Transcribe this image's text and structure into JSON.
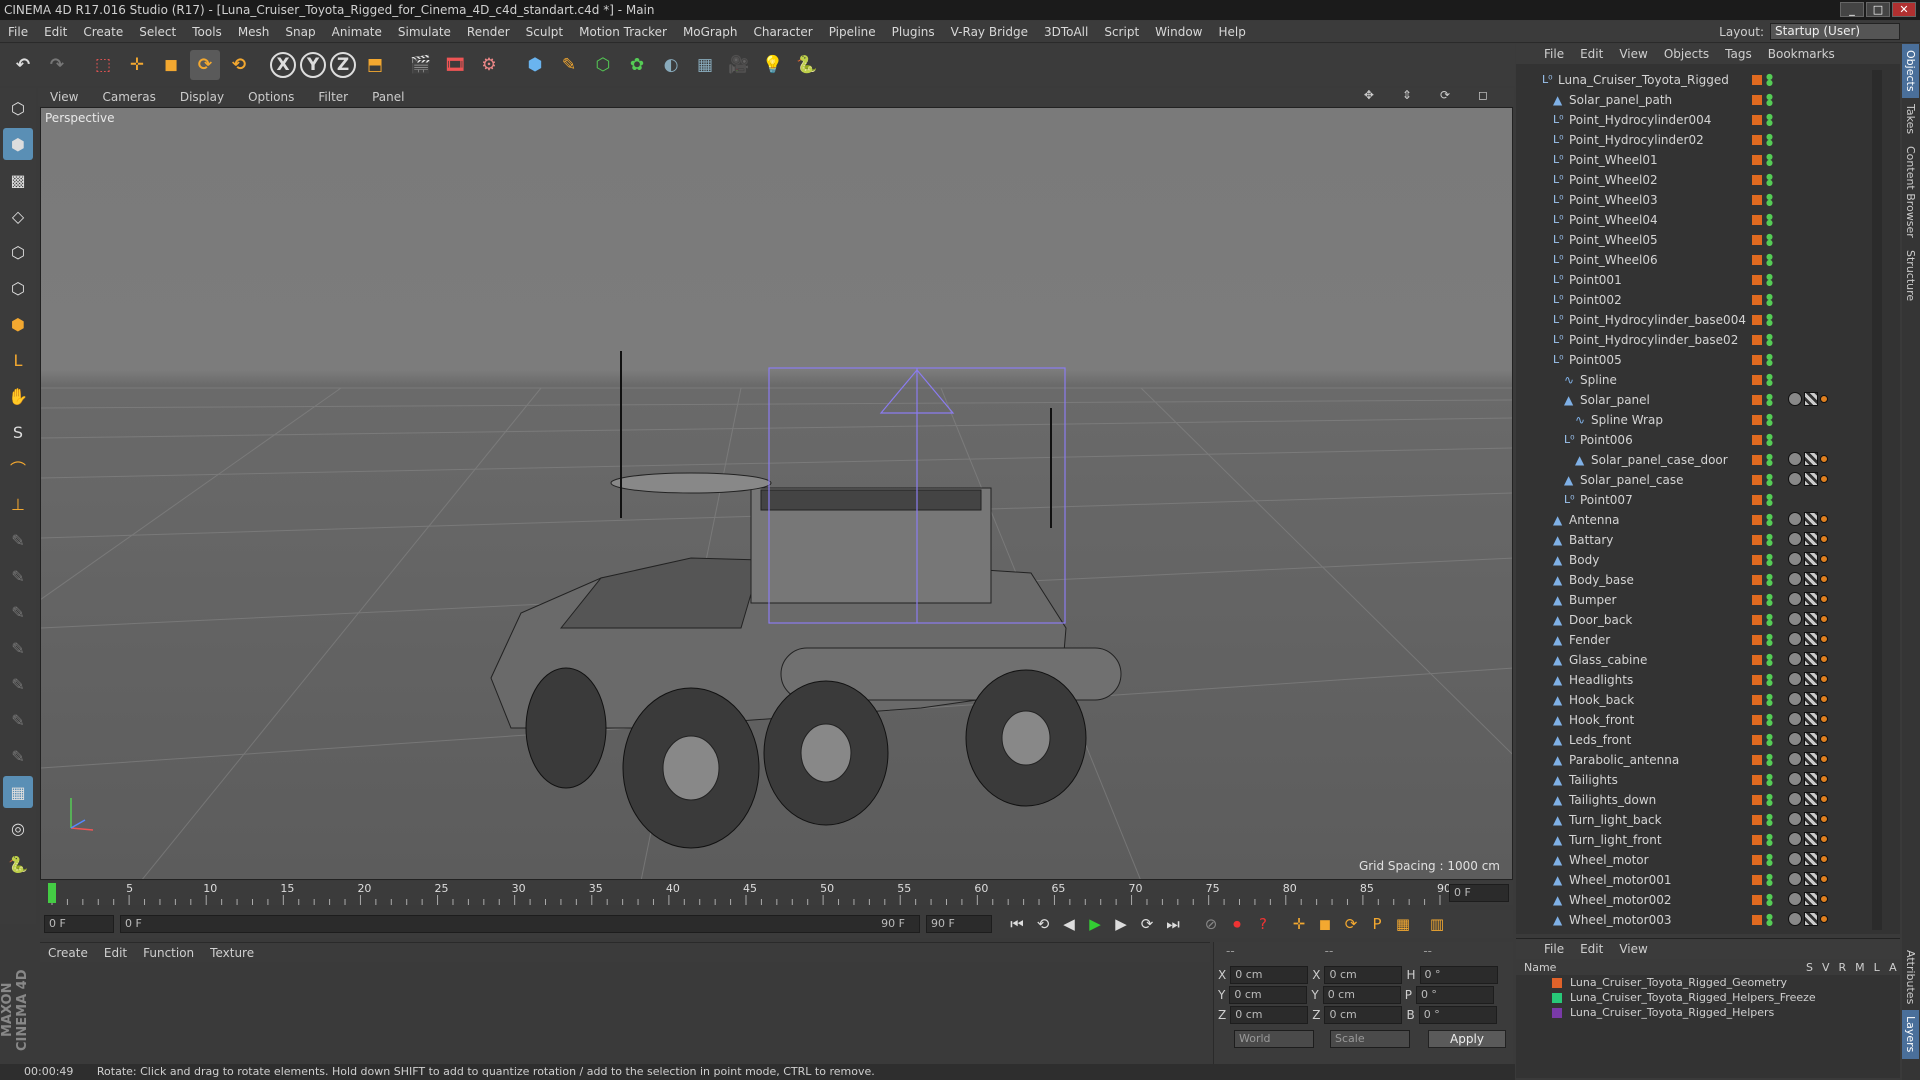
{
  "window": {
    "title": "CINEMA 4D R17.016 Studio (R17) - [Luna_Cruiser_Toyota_Rigged_for_Cinema_4D_c4d_standart.c4d *] - Main"
  },
  "menubar": [
    "File",
    "Edit",
    "Create",
    "Select",
    "Tools",
    "Mesh",
    "Snap",
    "Animate",
    "Simulate",
    "Render",
    "Sculpt",
    "Motion Tracker",
    "MoGraph",
    "Character",
    "Pipeline",
    "Plugins",
    "V-Ray Bridge",
    "3DToAll",
    "Script",
    "Window",
    "Help"
  ],
  "layout": {
    "label": "Layout:",
    "value": "Startup (User)"
  },
  "viewport": {
    "menu": [
      "View",
      "Cameras",
      "Display",
      "Options",
      "Filter",
      "Panel"
    ],
    "label": "Perspective",
    "grid_spacing": "Grid Spacing : 1000 cm"
  },
  "timeline": {
    "ticks": [
      "0",
      "5",
      "10",
      "15",
      "20",
      "25",
      "30",
      "35",
      "40",
      "45",
      "50",
      "55",
      "60",
      "65",
      "70",
      "75",
      "80",
      "85",
      "90"
    ],
    "current_frame_right": "0 F",
    "start_field": "0 F",
    "range_start": "0 F",
    "range_end": "90 F",
    "end_field": "90 F"
  },
  "material": {
    "menu": [
      "Create",
      "Edit",
      "Function",
      "Texture"
    ]
  },
  "attributes": {
    "header": [
      "--",
      "--",
      "--"
    ],
    "rows": [
      {
        "a": "X",
        "av": "0 cm",
        "b": "X",
        "bv": "0 cm",
        "c": "H",
        "cv": "0 °"
      },
      {
        "a": "Y",
        "av": "0 cm",
        "b": "Y",
        "bv": "0 cm",
        "c": "P",
        "cv": "0 °"
      },
      {
        "a": "Z",
        "av": "0 cm",
        "b": "Z",
        "bv": "0 cm",
        "c": "B",
        "cv": "0 °"
      }
    ],
    "coord_mode": "World",
    "scale_mode": "Scale",
    "apply": "Apply"
  },
  "status": {
    "time": "00:00:49",
    "message": "Rotate: Click and drag to rotate elements. Hold down SHIFT to add to quantize rotation / add to the selection in point mode, CTRL to remove."
  },
  "objects": {
    "menu": [
      "File",
      "Edit",
      "View",
      "Objects",
      "Tags",
      "Bookmarks"
    ],
    "items": [
      {
        "name": "Luna_Cruiser_Toyota_Rigged",
        "depth": 0,
        "icon": "null"
      },
      {
        "name": "Solar_panel_path",
        "depth": 1,
        "icon": "poly"
      },
      {
        "name": "Point_Hydrocylinder004",
        "depth": 1,
        "icon": "null"
      },
      {
        "name": "Point_Hydrocylinder02",
        "depth": 1,
        "icon": "null"
      },
      {
        "name": "Point_Wheel01",
        "depth": 1,
        "icon": "null"
      },
      {
        "name": "Point_Wheel02",
        "depth": 1,
        "icon": "null"
      },
      {
        "name": "Point_Wheel03",
        "depth": 1,
        "icon": "null"
      },
      {
        "name": "Point_Wheel04",
        "depth": 1,
        "icon": "null"
      },
      {
        "name": "Point_Wheel05",
        "depth": 1,
        "icon": "null"
      },
      {
        "name": "Point_Wheel06",
        "depth": 1,
        "icon": "null"
      },
      {
        "name": "Point001",
        "depth": 1,
        "icon": "null"
      },
      {
        "name": "Point002",
        "depth": 1,
        "icon": "null"
      },
      {
        "name": "Point_Hydrocylinder_base004",
        "depth": 1,
        "icon": "null"
      },
      {
        "name": "Point_Hydrocylinder_base02",
        "depth": 1,
        "icon": "null"
      },
      {
        "name": "Point005",
        "depth": 1,
        "icon": "null"
      },
      {
        "name": "Spline",
        "depth": 2,
        "icon": "spline"
      },
      {
        "name": "Solar_panel",
        "depth": 2,
        "icon": "poly"
      },
      {
        "name": "Spline Wrap",
        "depth": 3,
        "icon": "spline"
      },
      {
        "name": "Point006",
        "depth": 2,
        "icon": "null"
      },
      {
        "name": "Solar_panel_case_door",
        "depth": 3,
        "icon": "poly"
      },
      {
        "name": "Solar_panel_case",
        "depth": 2,
        "icon": "poly"
      },
      {
        "name": "Point007",
        "depth": 2,
        "icon": "null"
      },
      {
        "name": "Antenna",
        "depth": 1,
        "icon": "poly"
      },
      {
        "name": "Battary",
        "depth": 1,
        "icon": "poly"
      },
      {
        "name": "Body",
        "depth": 1,
        "icon": "poly"
      },
      {
        "name": "Body_base",
        "depth": 1,
        "icon": "poly"
      },
      {
        "name": "Bumper",
        "depth": 1,
        "icon": "poly"
      },
      {
        "name": "Door_back",
        "depth": 1,
        "icon": "poly"
      },
      {
        "name": "Fender",
        "depth": 1,
        "icon": "poly"
      },
      {
        "name": "Glass_cabine",
        "depth": 1,
        "icon": "poly"
      },
      {
        "name": "Headlights",
        "depth": 1,
        "icon": "poly"
      },
      {
        "name": "Hook_back",
        "depth": 1,
        "icon": "poly"
      },
      {
        "name": "Hook_front",
        "depth": 1,
        "icon": "poly"
      },
      {
        "name": "Leds_front",
        "depth": 1,
        "icon": "poly"
      },
      {
        "name": "Parabolic_antenna",
        "depth": 1,
        "icon": "poly"
      },
      {
        "name": "Tailights",
        "depth": 1,
        "icon": "poly"
      },
      {
        "name": "Tailights_down",
        "depth": 1,
        "icon": "poly"
      },
      {
        "name": "Turn_light_back",
        "depth": 1,
        "icon": "poly"
      },
      {
        "name": "Turn_light_front",
        "depth": 1,
        "icon": "poly"
      },
      {
        "name": "Wheel_motor",
        "depth": 1,
        "icon": "poly"
      },
      {
        "name": "Wheel_motor001",
        "depth": 1,
        "icon": "poly"
      },
      {
        "name": "Wheel_motor002",
        "depth": 1,
        "icon": "poly"
      },
      {
        "name": "Wheel_motor003",
        "depth": 1,
        "icon": "poly"
      }
    ]
  },
  "layers": {
    "menu": [
      "File",
      "Edit",
      "View"
    ],
    "header": {
      "name": "Name",
      "cols": [
        "S",
        "V",
        "R",
        "M",
        "L",
        "A"
      ]
    },
    "items": [
      {
        "name": "Luna_Cruiser_Toyota_Rigged_Geometry",
        "color": "#e0622a"
      },
      {
        "name": "Luna_Cruiser_Toyota_Rigged_Helpers_Freeze",
        "color": "#28c878"
      },
      {
        "name": "Luna_Cruiser_Toyota_Rigged_Helpers",
        "color": "#7a3aa8"
      }
    ]
  },
  "side_tabs": [
    "Objects",
    "Takes",
    "Content Browser",
    "Structure"
  ],
  "side_tabs_bottom": [
    "Attributes",
    "Layers"
  ]
}
